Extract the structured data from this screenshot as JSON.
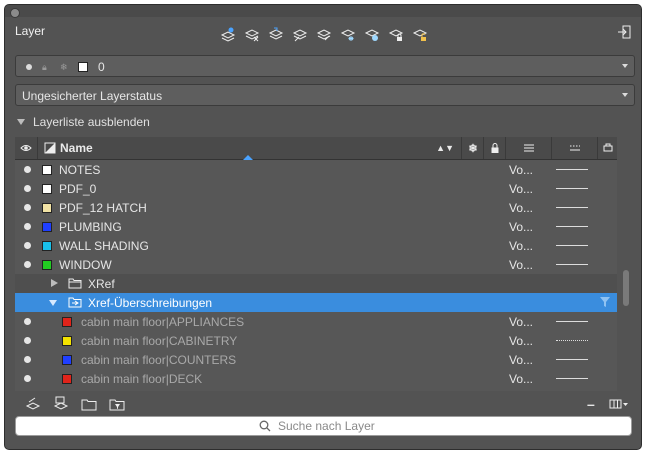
{
  "panel": {
    "title": "Layer"
  },
  "toolbar": {
    "icons": [
      "new-layer-icon",
      "delete-layer-icon",
      "set-current-icon",
      "layer-match-icon",
      "layer-previous-icon",
      "freeze-icon",
      "isolate-icon",
      "lock-icon",
      "unlock-icon"
    ]
  },
  "current_layer": {
    "name": "0",
    "color": "#ffffff"
  },
  "layer_state": {
    "value": "Ungesicherter Layerstatus"
  },
  "layer_list_toggle": {
    "label": "Layerliste ausblenden"
  },
  "columns": {
    "name": "Name"
  },
  "layers": [
    {
      "name": "NOTES",
      "color": "#ffffff",
      "linetype": "Vo...",
      "line": "solid",
      "dim": false
    },
    {
      "name": "PDF_0",
      "color": "#ffffff",
      "linetype": "Vo...",
      "line": "solid",
      "dim": false
    },
    {
      "name": "PDF_12 HATCH",
      "color": "#f2e3a5",
      "linetype": "Vo...",
      "line": "solid",
      "dim": false
    },
    {
      "name": "PLUMBING",
      "color": "#1f3fff",
      "linetype": "Vo...",
      "line": "solid",
      "dim": false
    },
    {
      "name": "WALL SHADING",
      "color": "#19c0ea",
      "linetype": "Vo...",
      "line": "solid",
      "dim": false
    },
    {
      "name": "WINDOW",
      "color": "#22cc22",
      "linetype": "Vo...",
      "line": "solid",
      "dim": false
    }
  ],
  "groups": [
    {
      "name": "XRef",
      "selected": false
    },
    {
      "name": "Xref-Überschreibungen",
      "selected": true
    }
  ],
  "xref_layers": [
    {
      "name": "cabin main floor|APPLIANCES",
      "color": "#e0241b",
      "linetype": "Vo...",
      "line": "solid"
    },
    {
      "name": "cabin main floor|CABINETRY",
      "color": "#f4e300",
      "linetype": "Vo...",
      "line": "dotted"
    },
    {
      "name": "cabin main floor|COUNTERS",
      "color": "#1f3fff",
      "linetype": "Vo...",
      "line": "solid"
    },
    {
      "name": "cabin main floor|DECK",
      "color": "#e0241b",
      "linetype": "Vo...",
      "line": "solid"
    }
  ],
  "search": {
    "placeholder": "Suche nach Layer"
  },
  "colors": {
    "accent": "#3a8dde",
    "panel_bg": "#535353"
  }
}
